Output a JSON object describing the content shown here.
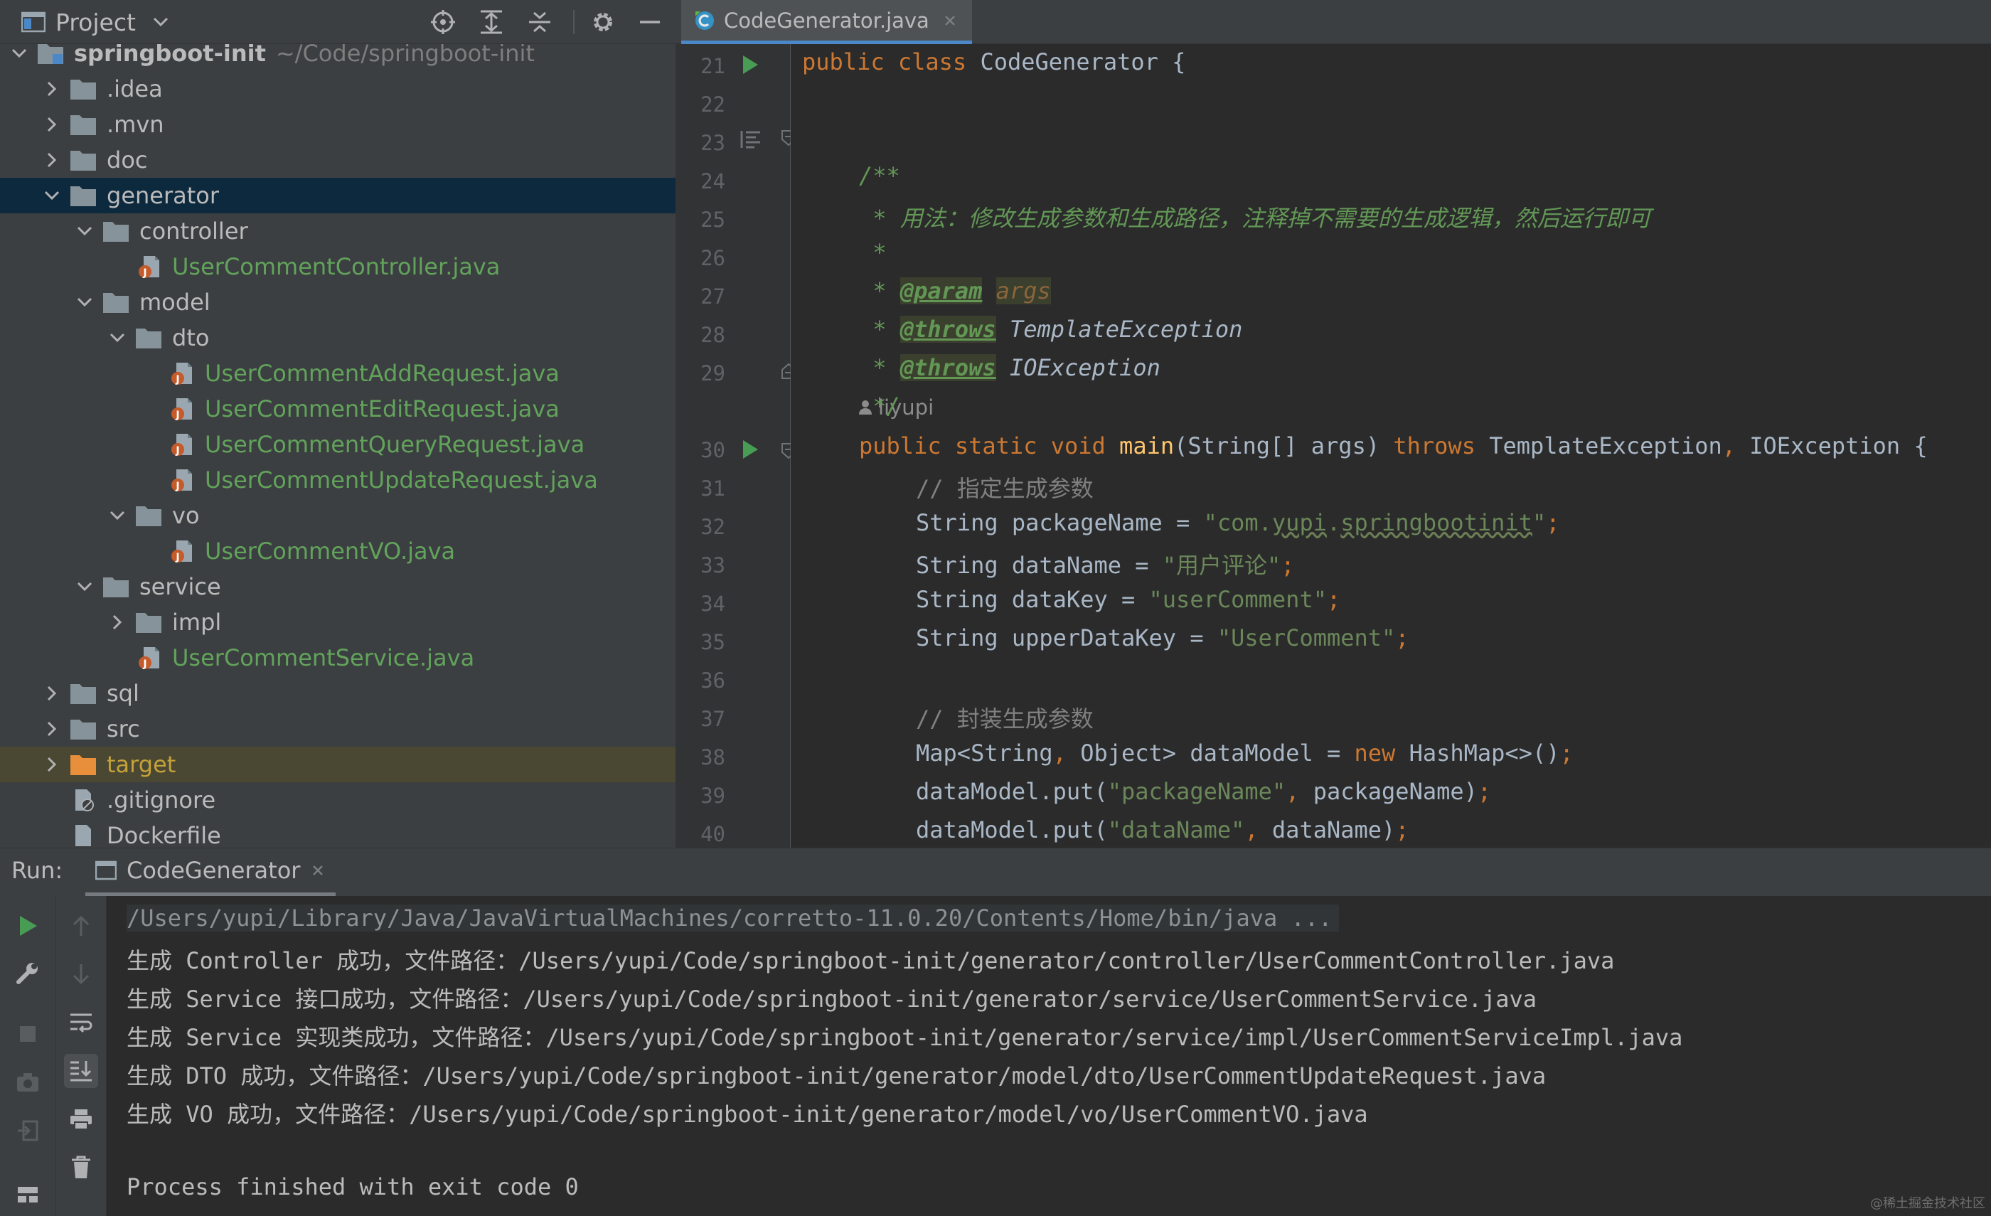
{
  "project_panel": {
    "title": "Project",
    "tree": [
      {
        "name": "springboot-init",
        "path": "~/Code/springboot-init",
        "kind": "module",
        "expanded": true,
        "depth": 0
      },
      {
        "name": ".idea",
        "kind": "folder",
        "expanded": false,
        "depth": 1
      },
      {
        "name": ".mvn",
        "kind": "folder",
        "expanded": false,
        "depth": 1
      },
      {
        "name": "doc",
        "kind": "folder",
        "expanded": false,
        "depth": 1
      },
      {
        "name": "generator",
        "kind": "folder",
        "expanded": true,
        "depth": 1,
        "selected": true
      },
      {
        "name": "controller",
        "kind": "folder",
        "expanded": true,
        "depth": 2
      },
      {
        "name": "UserCommentController.java",
        "kind": "java",
        "depth": 3
      },
      {
        "name": "model",
        "kind": "folder",
        "expanded": true,
        "depth": 2
      },
      {
        "name": "dto",
        "kind": "folder",
        "expanded": true,
        "depth": 3
      },
      {
        "name": "UserCommentAddRequest.java",
        "kind": "java",
        "depth": 4
      },
      {
        "name": "UserCommentEditRequest.java",
        "kind": "java",
        "depth": 4
      },
      {
        "name": "UserCommentQueryRequest.java",
        "kind": "java",
        "depth": 4
      },
      {
        "name": "UserCommentUpdateRequest.java",
        "kind": "java",
        "depth": 4
      },
      {
        "name": "vo",
        "kind": "folder",
        "expanded": true,
        "depth": 3
      },
      {
        "name": "UserCommentVO.java",
        "kind": "java",
        "depth": 4
      },
      {
        "name": "service",
        "kind": "folder",
        "expanded": true,
        "depth": 2
      },
      {
        "name": "impl",
        "kind": "folder",
        "expanded": false,
        "depth": 3
      },
      {
        "name": "UserCommentService.java",
        "kind": "java",
        "depth": 3
      },
      {
        "name": "sql",
        "kind": "folder",
        "expanded": false,
        "depth": 1
      },
      {
        "name": "src",
        "kind": "folder",
        "expanded": false,
        "depth": 1
      },
      {
        "name": "target",
        "kind": "excluded-folder",
        "expanded": false,
        "depth": 1
      },
      {
        "name": ".gitignore",
        "kind": "gitignore",
        "depth": 1
      },
      {
        "name": "Dockerfile",
        "kind": "file",
        "depth": 1
      }
    ]
  },
  "editor": {
    "tab_label": "CodeGenerator.java",
    "author_hint": "liyupi",
    "line_numbers": [
      "21",
      "22",
      "23",
      "24",
      "25",
      "26",
      "27",
      "28",
      "29",
      "30",
      "31",
      "32",
      "33",
      "34",
      "35",
      "36",
      "37",
      "38",
      "39",
      "40"
    ],
    "code": {
      "l21_kw": "public class ",
      "l21_rest": "CodeGenerator {",
      "l23": "/**",
      "l24": " * 用法：修改生成参数和生成路径，注释掉不需要的生成逻辑，然后运行即可",
      "l25": " *",
      "l26_prefix": " * ",
      "l26_tag": "@param",
      "l26_param": "args",
      "l27_prefix": " * ",
      "l27_tag": "@throws",
      "l27_type": "TemplateException",
      "l28_prefix": " * ",
      "l28_tag": "@throws",
      "l28_type": "IOException",
      "l29": " */",
      "l30_kw": "public static void ",
      "l30_fn": "main",
      "l30_args": "(String[] args) ",
      "l30_throws": "throws",
      "l30_t1": " TemplateException",
      "l30_comma": ",",
      "l30_t2": " IOException {",
      "l31": "// 指定生成参数",
      "l32_a": "String packageName = ",
      "l32_q1": "\"com.",
      "l32_w1": "yupi",
      "l32_dot": ".",
      "l32_w2": "springbootinit",
      "l32_q2": "\"",
      "l32_semi": ";",
      "l33_a": "String dataName = ",
      "l33_str": "\"用户评论\"",
      "l33_semi": ";",
      "l34_a": "String dataKey = ",
      "l34_str": "\"userComment\"",
      "l34_semi": ";",
      "l35_a": "String upperDataKey = ",
      "l35_str": "\"UserComment\"",
      "l35_semi": ";",
      "l37": "// 封装生成参数",
      "l38_a": "Map<String",
      "l38_comma": ",",
      "l38_b": " Object> dataModel = ",
      "l38_new": "new",
      "l38_c": " HashMap<>()",
      "l38_semi": ";",
      "l39_a": "dataModel.put(",
      "l39_str": "\"packageName\"",
      "l39_comma": ",",
      "l39_b": " packageName)",
      "l39_semi": ";",
      "l40_a": "dataModel.put(",
      "l40_str": "\"dataName\"",
      "l40_comma": ",",
      "l40_b": " dataName)",
      "l40_semi": ";"
    }
  },
  "run_panel": {
    "label": "Run:",
    "tab_label": "CodeGenerator",
    "console": [
      "/Users/yupi/Library/Java/JavaVirtualMachines/corretto-11.0.20/Contents/Home/bin/java ...",
      "生成 Controller 成功，文件路径：/Users/yupi/Code/springboot-init/generator/controller/UserCommentController.java",
      "生成 Service 接口成功，文件路径：/Users/yupi/Code/springboot-init/generator/service/UserCommentService.java",
      "生成 Service 实现类成功，文件路径：/Users/yupi/Code/springboot-init/generator/service/impl/UserCommentServiceImpl.java",
      "生成 DTO 成功，文件路径：/Users/yupi/Code/springboot-init/generator/model/dto/UserCommentUpdateRequest.java",
      "生成 VO 成功，文件路径：/Users/yupi/Code/springboot-init/generator/model/vo/UserCommentVO.java",
      "",
      "Process finished with exit code 0"
    ]
  },
  "watermark": "@稀土掘金技术社区",
  "icons": {
    "project_view": "project-view-icon",
    "locate": "locate-icon",
    "expand_all": "expand-all-icon",
    "collapse_all": "collapse-all-icon",
    "settings": "gear-icon",
    "hide": "minimize-icon",
    "java_class": "java-class-icon",
    "run_gutter": "run-gutter-icon",
    "rerun": "rerun-icon",
    "stop": "stop-icon"
  },
  "colors": {
    "accent": "#4a88c7",
    "keyword": "#cc7832",
    "string": "#6a8759",
    "doc_comment": "#629755",
    "run_green": "#499c54",
    "vcs_added": "#62a35b"
  }
}
